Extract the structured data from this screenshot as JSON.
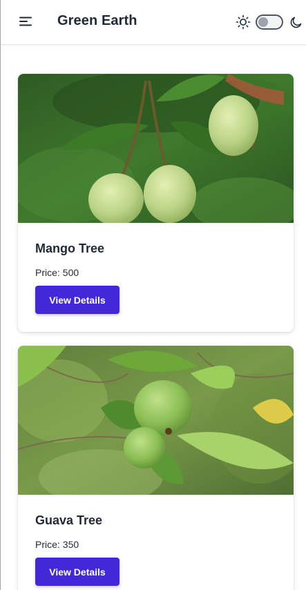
{
  "header": {
    "brand": "Green Earth",
    "icons": {
      "menu": "hamburger-menu-icon",
      "light": "sun-icon",
      "dark": "moon-icon"
    },
    "theme_toggle_on": false
  },
  "colors": {
    "accent": "#4228d8",
    "text": "#1f2937",
    "toggle_border": "#4b5563"
  },
  "products": [
    {
      "name": "Mango Tree",
      "price_label": "Price:",
      "price": "500",
      "button_label": "View Details"
    },
    {
      "name": "Guava Tree",
      "price_label": "Price:",
      "price": "350",
      "button_label": "View Details"
    }
  ]
}
